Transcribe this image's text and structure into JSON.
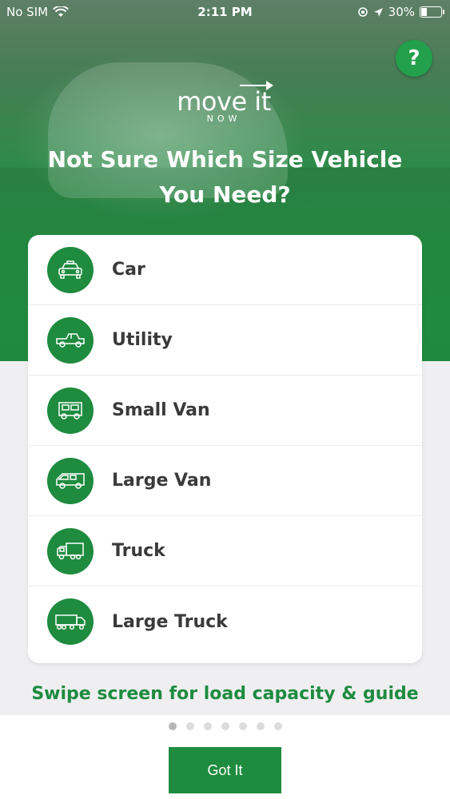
{
  "status_bar": {
    "carrier": "No SIM",
    "time": "2:11 PM",
    "battery": "30%",
    "battery_level": 0.3
  },
  "header": {
    "help_label": "?",
    "logo_main": "move it",
    "logo_sub": "NOW",
    "title": "Not Sure Which Size Vehicle You Need?"
  },
  "vehicles": [
    {
      "label": "Car",
      "icon": "car-icon"
    },
    {
      "label": "Utility",
      "icon": "pickup-truck-icon"
    },
    {
      "label": "Small Van",
      "icon": "small-van-icon"
    },
    {
      "label": "Large Van",
      "icon": "large-van-icon"
    },
    {
      "label": "Truck",
      "icon": "truck-icon"
    },
    {
      "label": "Large Truck",
      "icon": "large-truck-icon"
    }
  ],
  "swipe_hint": "Swipe screen for load capacity & guide",
  "pager": {
    "count": 7,
    "active": 0
  },
  "got_it_label": "Got It",
  "colors": {
    "brand_green": "#1e8b3f",
    "help_green": "#23a04b"
  }
}
